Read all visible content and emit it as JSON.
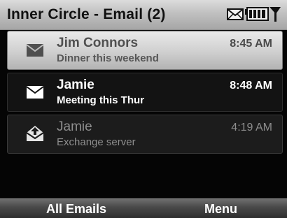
{
  "titlebar": {
    "title": "Inner Circle - Email (2)",
    "status_icons": [
      "envelope-icon",
      "battery-icon",
      "signal-icon"
    ]
  },
  "messages": [
    {
      "sender": "Jim Connors",
      "subject": "Dinner this weekend",
      "time": "8:45 AM",
      "state": "selected",
      "icon": "envelope-icon"
    },
    {
      "sender": "Jamie",
      "subject": "Meeting this Thur",
      "time": "8:48 AM",
      "state": "unread",
      "icon": "envelope-icon"
    },
    {
      "sender": "Jamie",
      "subject": "Exchange server",
      "time": "4:19 AM",
      "state": "read",
      "icon": "open-envelope-icon"
    }
  ],
  "softkeys": {
    "left": "All Emails",
    "right": "Menu"
  },
  "colors": {
    "titlebar": "#c0c0c0",
    "background": "#050505",
    "unread_text": "#ffffff",
    "read_text": "#8e8e8e"
  }
}
